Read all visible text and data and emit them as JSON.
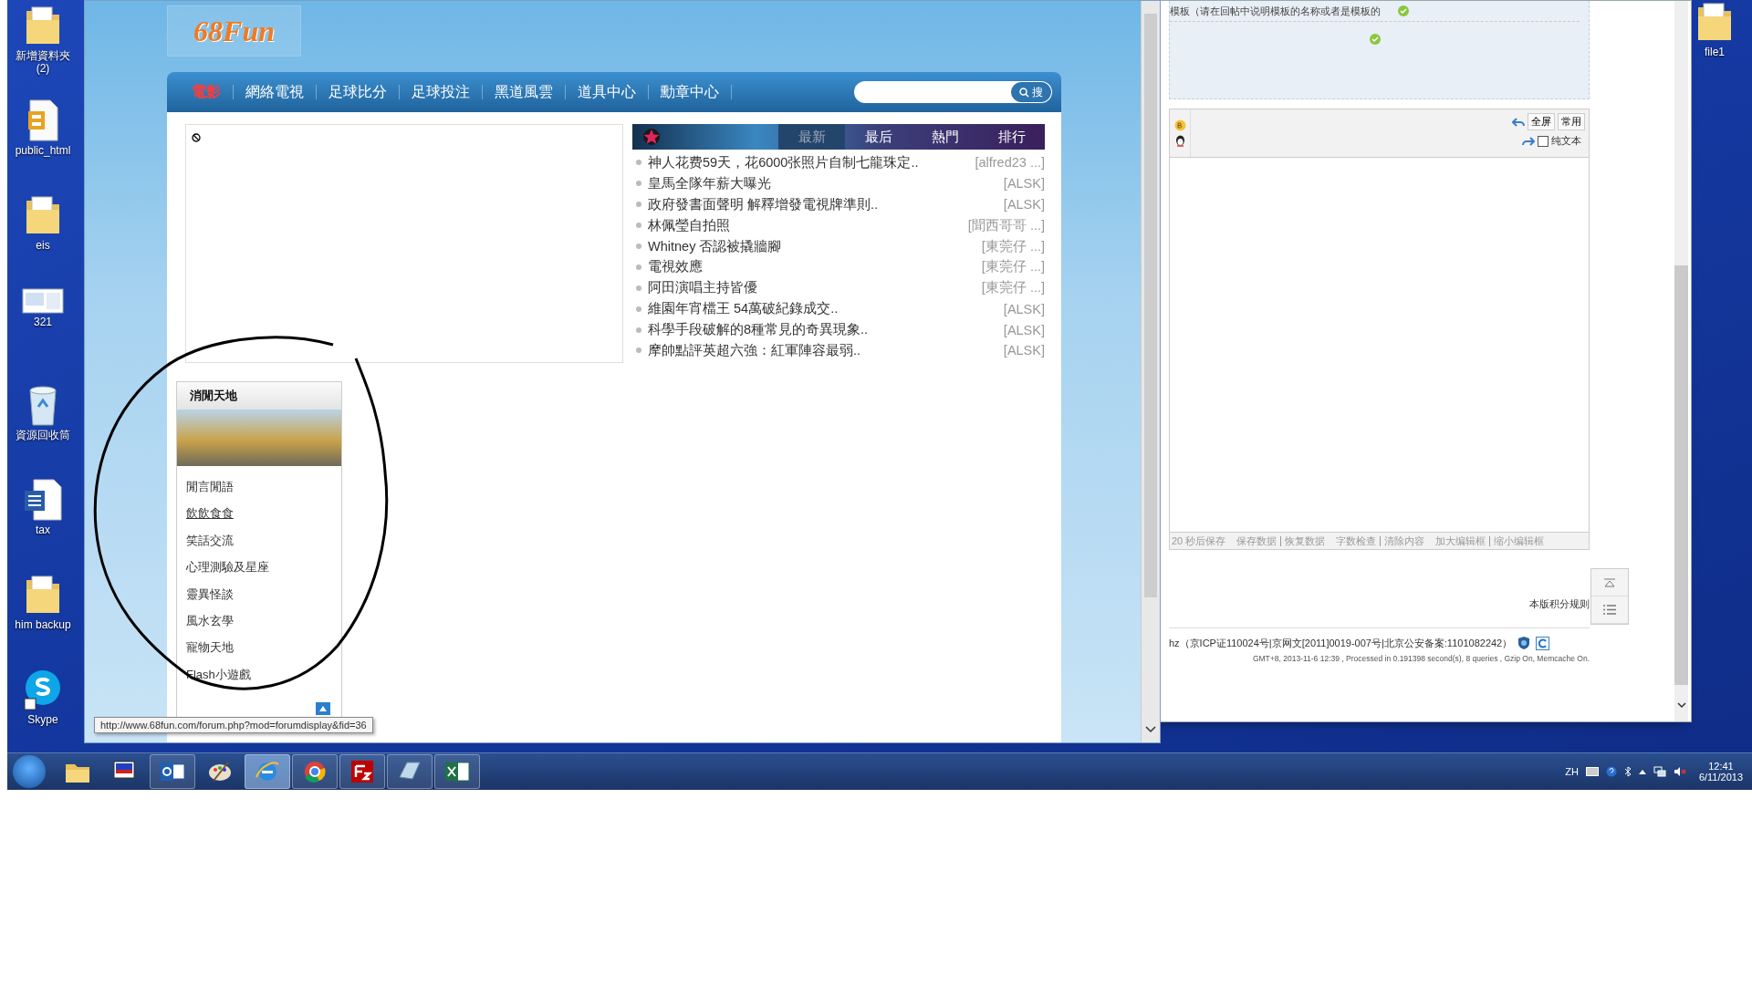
{
  "desktop_icons": [
    {
      "label": "新增資料夾 (2)",
      "kind": "folder"
    },
    {
      "label": "public_html",
      "kind": "zip"
    },
    {
      "label": "eis",
      "kind": "folder"
    },
    {
      "label": "321",
      "kind": "image"
    },
    {
      "label": "資源回收筒",
      "kind": "recycle"
    },
    {
      "label": "tax",
      "kind": "word"
    },
    {
      "label": "him backup",
      "kind": "folder"
    },
    {
      "label": "Skype",
      "kind": "skype"
    }
  ],
  "right_icon": {
    "label": "file1",
    "kind": "folder"
  },
  "browser": {
    "logo": "68Fun",
    "nav": [
      {
        "label": "電影",
        "selected": true
      },
      {
        "label": "網絡電視",
        "selected": false
      },
      {
        "label": "足球比分",
        "selected": false
      },
      {
        "label": "足球投注",
        "selected": false
      },
      {
        "label": "黑道風雲",
        "selected": false
      },
      {
        "label": "道具中心",
        "selected": false
      },
      {
        "label": "勳章中心",
        "selected": false
      }
    ],
    "search_button": "搜",
    "news": {
      "tabs": [
        {
          "label": "最新",
          "selected": true
        },
        {
          "label": "最后",
          "selected": false
        },
        {
          "label": "熱門",
          "selected": false
        },
        {
          "label": "排行",
          "selected": false
        }
      ],
      "items": [
        {
          "title": "神人花费59天，花6000张照片自制七龍珠定..",
          "author": "[alfred23 ...]"
        },
        {
          "title": "皇馬全隊年薪大曝光",
          "author": "[ALSK]"
        },
        {
          "title": "政府發書面聲明 解釋增發電視牌準則..",
          "author": "[ALSK]"
        },
        {
          "title": "林佩瑩自拍照",
          "author": "[聞西哥哥 ...]"
        },
        {
          "title": "Whitney 否認被撬牆腳",
          "author": "[東莞仔 ...]"
        },
        {
          "title": "電視效應",
          "author": "[東莞仔 ...]"
        },
        {
          "title": "阿田演唱主持皆優",
          "author": "[東莞仔 ...]"
        },
        {
          "title": "維園年宵檔王 54萬破紀錄成交..",
          "author": "[ALSK]"
        },
        {
          "title": "科學手段破解的8種常見的奇異現象..",
          "author": "[ALSK]"
        },
        {
          "title": "摩帥點評英超六強：紅軍陣容最弱..",
          "author": "[ALSK]"
        }
      ]
    },
    "sidebar": {
      "title": "消閒天地",
      "links": [
        {
          "label": "閒言閒語",
          "hovered": false
        },
        {
          "label": "飲飲食食",
          "hovered": true
        },
        {
          "label": "笑話交流",
          "hovered": false
        },
        {
          "label": "心理測驗及星座",
          "hovered": false
        },
        {
          "label": "靈異怪談",
          "hovered": false
        },
        {
          "label": "風水玄學",
          "hovered": false
        },
        {
          "label": "寵物天地",
          "hovered": false
        },
        {
          "label": "Flash小遊戲",
          "hovered": false
        }
      ]
    },
    "status_url": "http://www.68fun.com/forum.php?mod=forumdisplay&fid=36"
  },
  "editor_window": {
    "form_text": "模板（请在回帖中说明模板的名称或者是模板的",
    "toolbar": {
      "buttons": [
        "全屏",
        "常用"
      ],
      "plain_text": {
        "label": "纯文本",
        "checked": false
      }
    },
    "footer_groups": [
      [
        "20 秒后保存"
      ],
      [
        "保存数据",
        "恢复数据"
      ],
      [
        "字数检查",
        "清除内容"
      ],
      [
        "加大编辑框",
        "缩小编辑框"
      ]
    ],
    "rules_link": "本版积分规则",
    "icp": "hz（京ICP证110024号|京网文[2011]0019-007号|北京公安备案:1101082242）",
    "stats": "GMT+8, 2013-11-6 12:39 , Processed in 0.191398 second(s), 8 queries , Gzip On, Memcache On."
  },
  "taskbar": {
    "apps": [
      {
        "kind": "explorer",
        "running": false,
        "active": false
      },
      {
        "kind": "tvs",
        "running": false,
        "active": false
      },
      {
        "kind": "outlook",
        "running": true,
        "active": false
      },
      {
        "kind": "paint",
        "running": false,
        "active": false
      },
      {
        "kind": "ie",
        "running": true,
        "active": true
      },
      {
        "kind": "chrome",
        "running": true,
        "active": false
      },
      {
        "kind": "filezilla",
        "running": true,
        "active": false
      },
      {
        "kind": "app",
        "running": true,
        "active": false
      },
      {
        "kind": "excel",
        "running": true,
        "active": false
      }
    ],
    "language": "ZH",
    "time": "12:41",
    "date": "6/11/2013"
  }
}
